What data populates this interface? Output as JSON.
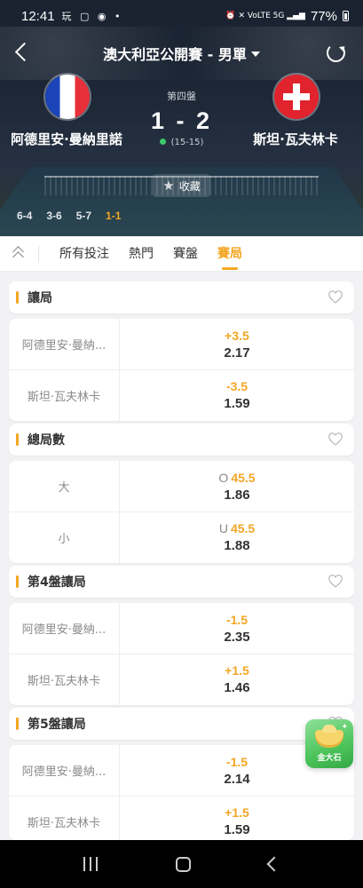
{
  "status_bar": {
    "time": "12:41",
    "left_icons": "玩 ▢ ◉ •",
    "signal_icons": "⏰ ✕ VoLTE 5G ▂▄▆",
    "battery": "77%"
  },
  "header": {
    "title": "澳大利亞公開賽 - 男單",
    "set_label": "第四盤",
    "score": "1 - 2",
    "game_score": "(15-15)",
    "favorite_label": "收藏",
    "home_player": "阿德里安·曼納里諾",
    "away_player": "斯坦·瓦夫林卡",
    "set_scores": [
      "6-4",
      "3-6",
      "5-7",
      "1-1"
    ]
  },
  "tabs": [
    "所有投注",
    "熱門",
    "賽盤",
    "賽局"
  ],
  "active_tab": "賽局",
  "markets": [
    {
      "title": "讓局",
      "rows": [
        {
          "label": "阿德里安·曼納...",
          "prefix": "",
          "line": "+3.5",
          "price": "2.17"
        },
        {
          "label": "斯坦·瓦夫林卡",
          "prefix": "",
          "line": "-3.5",
          "price": "1.59"
        }
      ]
    },
    {
      "title": "總局數",
      "rows": [
        {
          "label": "大",
          "prefix": "O",
          "line": "45.5",
          "price": "1.86"
        },
        {
          "label": "小",
          "prefix": "U",
          "line": "45.5",
          "price": "1.88"
        }
      ]
    },
    {
      "title": "第4盤讓局",
      "rows": [
        {
          "label": "阿德里安·曼納...",
          "prefix": "",
          "line": "-1.5",
          "price": "2.35"
        },
        {
          "label": "斯坦·瓦夫林卡",
          "prefix": "",
          "line": "+1.5",
          "price": "1.46"
        }
      ]
    },
    {
      "title": "第5盤讓局",
      "rows": [
        {
          "label": "阿德里安·曼納...",
          "prefix": "",
          "line": "-1.5",
          "price": "2.14"
        },
        {
          "label": "斯坦·瓦夫林卡",
          "prefix": "",
          "line": "+1.5",
          "price": "1.59"
        }
      ]
    }
  ],
  "promo": {
    "label": "金大石"
  },
  "colors": {
    "accent": "#f3a623",
    "header_bg": "#1d2736",
    "live_dot": "#3dc86b"
  },
  "icons": {
    "back": "chevron-left-icon",
    "refresh": "refresh-icon",
    "favorite": "star-icon",
    "market_favorite": "heart-icon",
    "collapse": "double-chevron-up-icon"
  }
}
